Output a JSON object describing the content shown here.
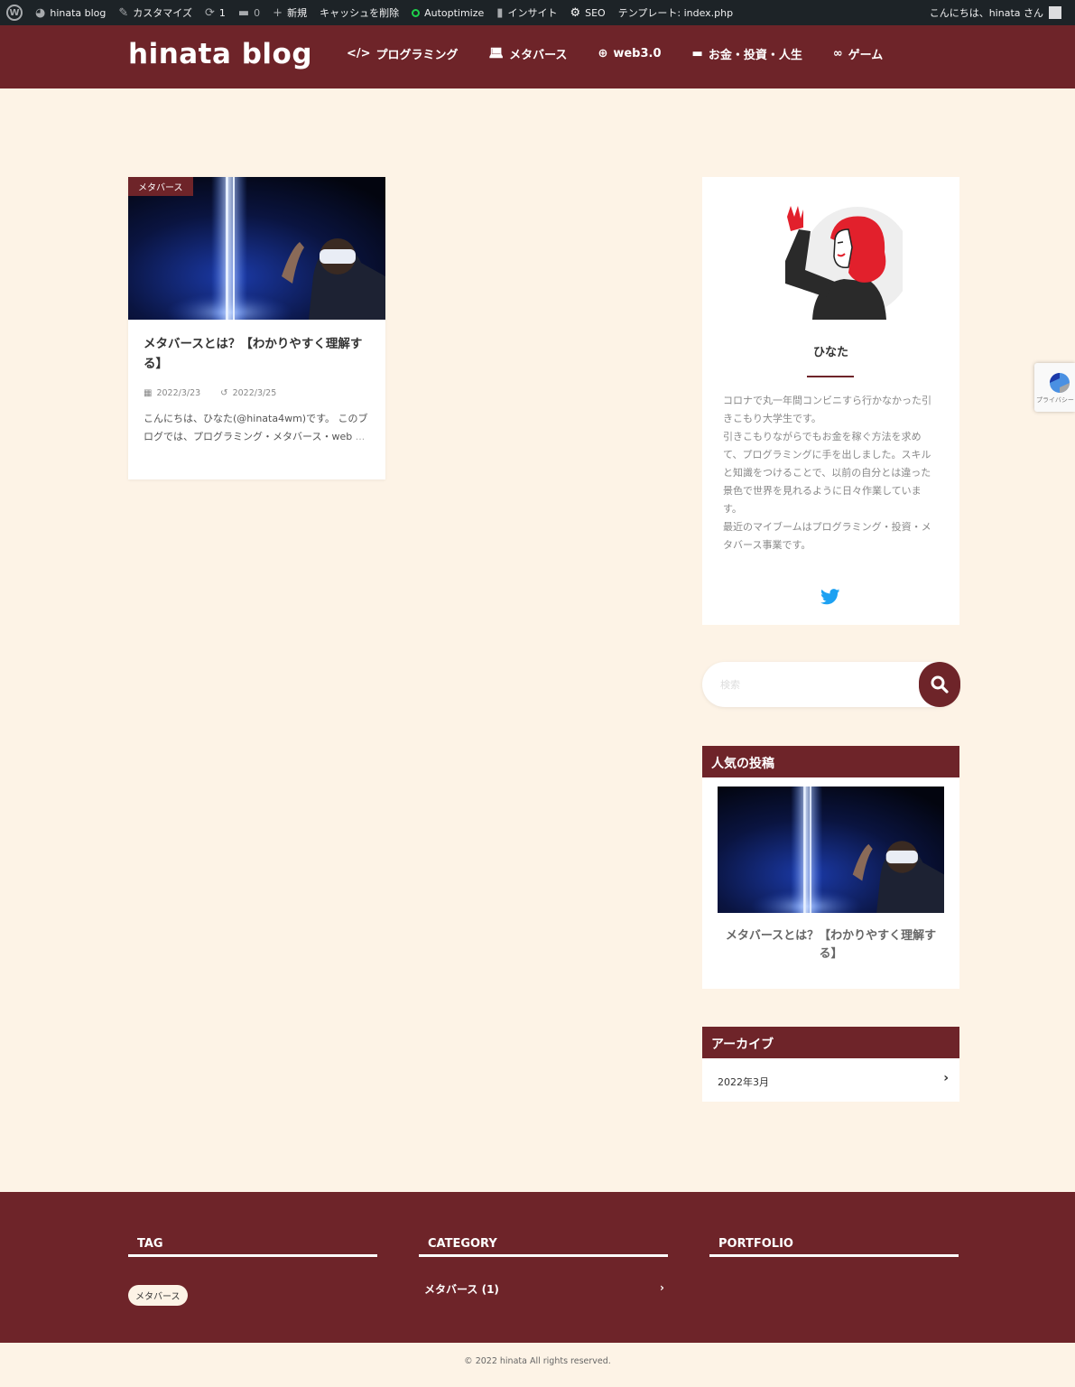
{
  "adminbar": {
    "site": "hinata blog",
    "customize": "カスタマイズ",
    "updates": "1",
    "comments": "0",
    "new": "新規",
    "cache": "キャッシュを削除",
    "autoptimize": "Autoptimize",
    "insight": "インサイト",
    "seo": "SEO",
    "template": "テンプレート: index.php",
    "greeting": "こんにちは、hinata さん"
  },
  "header": {
    "title": "hinata blog",
    "nav": [
      {
        "label": "プログラミング",
        "icon": "code-icon"
      },
      {
        "label": "メタバース",
        "icon": "laptop-icon"
      },
      {
        "label": "web3.0",
        "icon": "globe-icon"
      },
      {
        "label": "お金・投資・人生",
        "icon": "wallet-icon"
      },
      {
        "label": "ゲーム",
        "icon": "gamepad-icon"
      }
    ]
  },
  "post": {
    "category": "メタバース",
    "title": "メタバースとは？【わかりやすく理解する】",
    "published": "2022/3/23",
    "updated": "2022/3/25",
    "excerpt": "こんにちは、ひなた(@hinata4wm)です。 このブログでは、プログラミング・メタバース・web",
    "more": "..."
  },
  "profile": {
    "name": "ひなた",
    "bio": "コロナで丸一年間コンビニすら行かなかった引きこもり大学生です。\n引きこもりながらでもお金を稼ぐ方法を求めて、プログラミングに手を出しました。スキルと知識をつけることで、以前の自分とは違った景色で世界を見れるように日々作業しています。\n最近のマイブームはプログラミング・投資・メタバース事業です。"
  },
  "search": {
    "placeholder": "検索"
  },
  "popular": {
    "heading": "人気の投稿",
    "title": "メタバースとは？【わかりやすく理解する】"
  },
  "archive": {
    "heading": "アーカイブ",
    "item": "2022年3月"
  },
  "footer": {
    "tag_title": "TAG",
    "tag": "メタバース",
    "category_title": "CATEGORY",
    "category": "メタバース (1)",
    "portfolio_title": "PORTFOLIO",
    "copyright": "© 2022 hinata All rights reserved."
  },
  "recaptcha": {
    "text": "プライバシー・利用規約"
  },
  "colors": {
    "brand": "#6e2429",
    "background": "#fdf3e6",
    "twitter": "#1da1f2"
  }
}
